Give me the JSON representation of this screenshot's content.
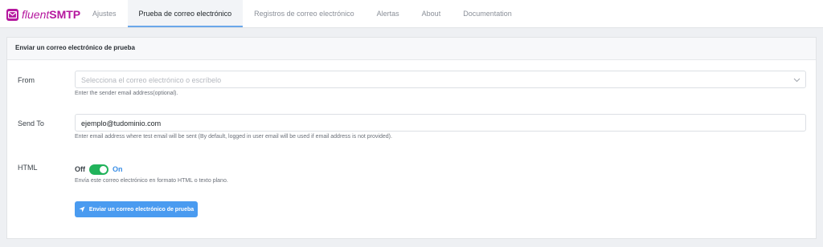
{
  "brand": {
    "name_a": "fluent",
    "name_b": "SMTP",
    "color": "#b5179e"
  },
  "tabs": [
    {
      "label": "Ajustes",
      "active": false
    },
    {
      "label": "Prueba de correo electrónico",
      "active": true
    },
    {
      "label": "Registros de correo electrónico",
      "active": false
    },
    {
      "label": "Alertas",
      "active": false
    },
    {
      "label": "About",
      "active": false
    },
    {
      "label": "Documentation",
      "active": false
    }
  ],
  "panel": {
    "title": "Enviar un correo electrónico de prueba"
  },
  "form": {
    "from": {
      "label": "From",
      "placeholder": "Selecciona el correo electrónico o escríbelo",
      "help": "Enter the sender email address(optional)."
    },
    "send_to": {
      "label": "Send To",
      "value": "ejemplo@tudominio.com",
      "help": "Enter email address where test email will be sent (By default, logged in user email will be used if email address is not provided)."
    },
    "html": {
      "label": "HTML",
      "off_label": "Off",
      "on_label": "On",
      "enabled": true,
      "help": "Envía este correo electrónico en formato HTML o texto plano."
    },
    "submit_label": "Enviar un correo electrónico de prueba"
  },
  "colors": {
    "accent": "#4a9bf0",
    "toggle_on": "#21b35b",
    "active_tab_border": "#6aa7ea"
  }
}
